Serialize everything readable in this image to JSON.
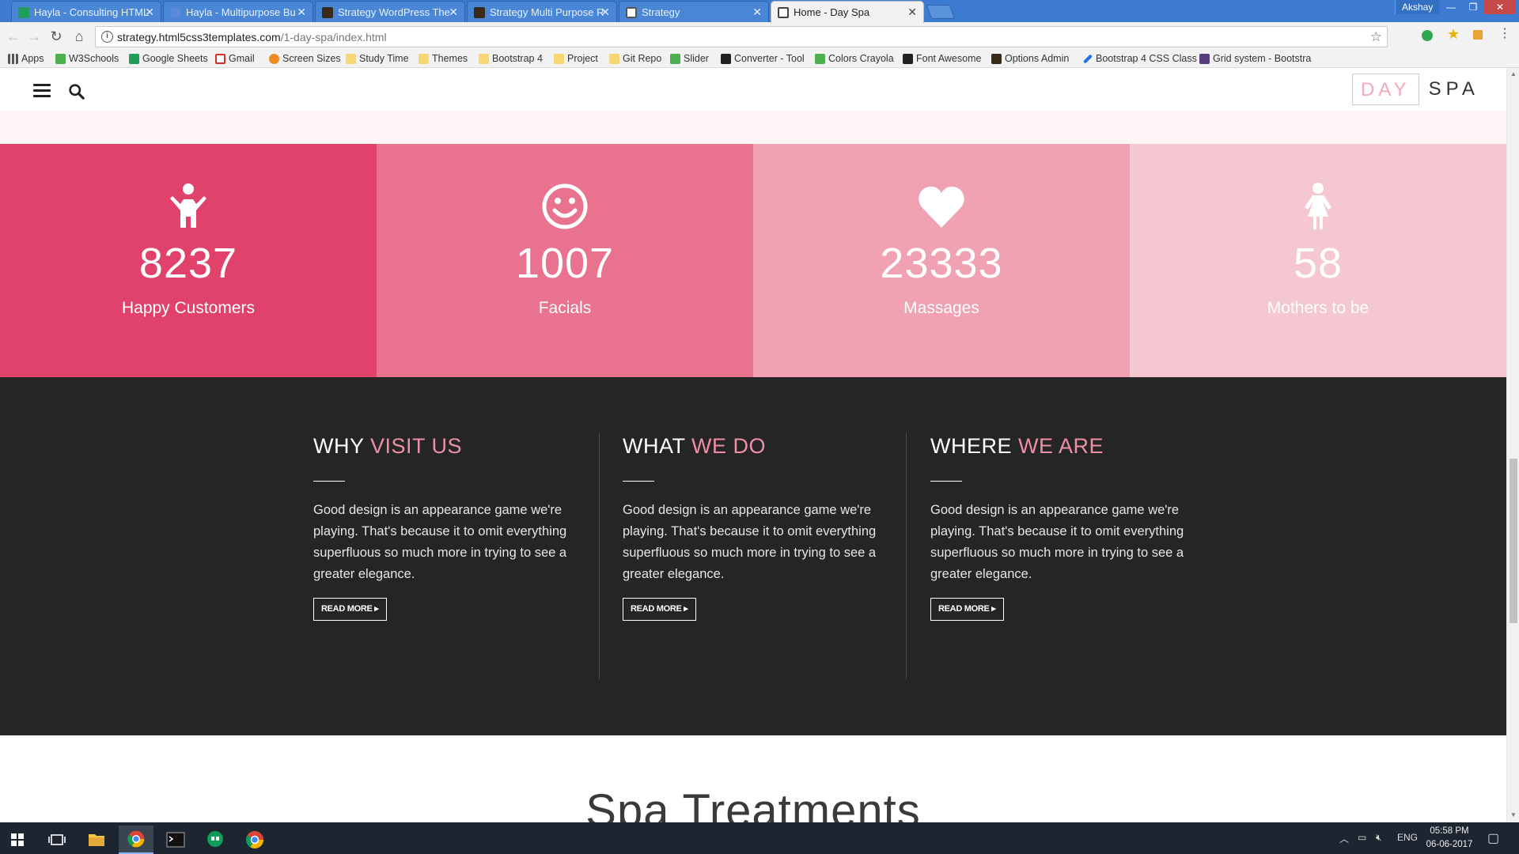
{
  "browser": {
    "tabs": [
      {
        "title": "Hayla - Consulting HTML",
        "favicon_color": "#1e9e5a"
      },
      {
        "title": "Hayla - Multipurpose Bu",
        "favicon_color": "#5b8bd8"
      },
      {
        "title": "Strategy WordPress The",
        "favicon_color": "#3a2a1a"
      },
      {
        "title": "Strategy Multi Purpose R",
        "favicon_color": "#3a2a1a"
      },
      {
        "title": "Strategy",
        "favicon_color": "#555555"
      },
      {
        "title": "Home - Day Spa",
        "favicon_color": "#444444"
      }
    ],
    "user": "Akshay",
    "url_host": "strategy.html5css3templates.com",
    "url_path": "/1-day-spa/index.html",
    "bookmarks": [
      {
        "label": "Apps",
        "icon_color": "#555555"
      },
      {
        "label": "W3Schools",
        "icon_color": "#4caf50"
      },
      {
        "label": "Google Sheets",
        "icon_color": "#1e9e5a"
      },
      {
        "label": "Gmail",
        "icon_color": "#d93025"
      },
      {
        "label": "Screen Sizes",
        "icon_color": "#f08a24"
      },
      {
        "label": "Study Time",
        "icon_color": "#f7d774"
      },
      {
        "label": "Themes",
        "icon_color": "#f7d774"
      },
      {
        "label": "Bootstrap 4",
        "icon_color": "#f7d774"
      },
      {
        "label": "Project",
        "icon_color": "#f7d774"
      },
      {
        "label": "Git Repo",
        "icon_color": "#f7d774"
      },
      {
        "label": "Slider",
        "icon_color": "#4caf50"
      },
      {
        "label": "Converter - Tool",
        "icon_color": "#222222"
      },
      {
        "label": "Colors Crayola",
        "icon_color": "#4caf50"
      },
      {
        "label": "Font Awesome",
        "icon_color": "#222222"
      },
      {
        "label": "Options Admin",
        "icon_color": "#3a2a1a"
      },
      {
        "label": "Bootstrap 4 CSS Class",
        "icon_color": "#1a73e8"
      },
      {
        "label": "Grid system - Bootstra",
        "icon_color": "#563d7c"
      }
    ]
  },
  "site": {
    "logo_day": "DAY",
    "logo_spa": "SPA",
    "stats": [
      {
        "icon": "child-icon",
        "number": "8237",
        "label": "Happy Customers",
        "bg": "#e1426b"
      },
      {
        "icon": "smile-icon",
        "number": "1007",
        "label": "Facials",
        "bg": "#e9728e"
      },
      {
        "icon": "heart-icon",
        "number": "23333",
        "label": "Massages",
        "bg": "#f0a2b2"
      },
      {
        "icon": "female-icon",
        "number": "58",
        "label": "Mothers to be",
        "bg": "#f5c7d0"
      }
    ],
    "columns": [
      {
        "title_plain": "WHY",
        "title_accent": "VISIT US",
        "body": "Good design is an appearance game we're playing. That's because it to omit everything superfluous so much more in trying to see a greater elegance.",
        "button": "READ MORE ▸"
      },
      {
        "title_plain": "WHAT",
        "title_accent": "WE DO",
        "body": "Good design is an appearance game we're playing. That's because it to omit everything superfluous so much more in trying to see a greater elegance.",
        "button": "READ MORE ▸"
      },
      {
        "title_plain": "WHERE",
        "title_accent": "WE ARE",
        "body": "Good design is an appearance game we're playing. That's because it to omit everything superfluous so much more in trying to see a greater elegance.",
        "button": "READ MORE ▸"
      }
    ],
    "treatments_heading": "Spa Treatments",
    "accent_color": "#ee8fa5"
  },
  "taskbar": {
    "language": "ENG",
    "time": "05:58 PM",
    "date": "06-06-2017"
  }
}
